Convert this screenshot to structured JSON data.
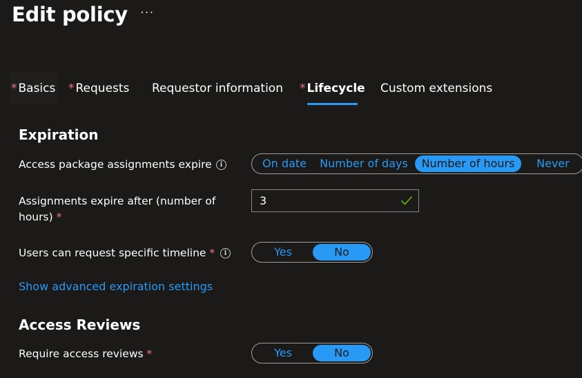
{
  "header": {
    "title": "Edit policy",
    "more_label": "···"
  },
  "tabs": [
    {
      "label": "Basics",
      "required": true
    },
    {
      "label": "Requests",
      "required": true
    },
    {
      "label": "Requestor information",
      "required": false
    },
    {
      "label": "Lifecycle",
      "required": true,
      "selected": true
    },
    {
      "label": "Custom extensions",
      "required": false
    }
  ],
  "required_marker": "*",
  "expiration": {
    "heading": "Expiration",
    "assignments_expire": {
      "label": "Access package assignments expire",
      "info_icon": "info-icon",
      "options": [
        "On date",
        "Number of days",
        "Number of hours",
        "Never"
      ],
      "selected": "Number of hours"
    },
    "expire_after": {
      "label": "Assignments expire after (number of hours)",
      "value": "3",
      "status_icon": "checkmark-icon"
    },
    "specific_timeline": {
      "label": "Users can request specific timeline",
      "info_icon": "info-icon",
      "options": [
        "Yes",
        "No"
      ],
      "selected": "No"
    },
    "advanced_link": "Show advanced expiration settings"
  },
  "access_reviews": {
    "heading": "Access Reviews",
    "require_reviews": {
      "label": "Require access reviews",
      "options": [
        "Yes",
        "No"
      ],
      "selected": "No"
    }
  },
  "colors": {
    "background": "#1b1a19",
    "accent": "#2899f5",
    "required": "#f1707b",
    "border": "#a19f9d",
    "success": "#6bb700"
  }
}
